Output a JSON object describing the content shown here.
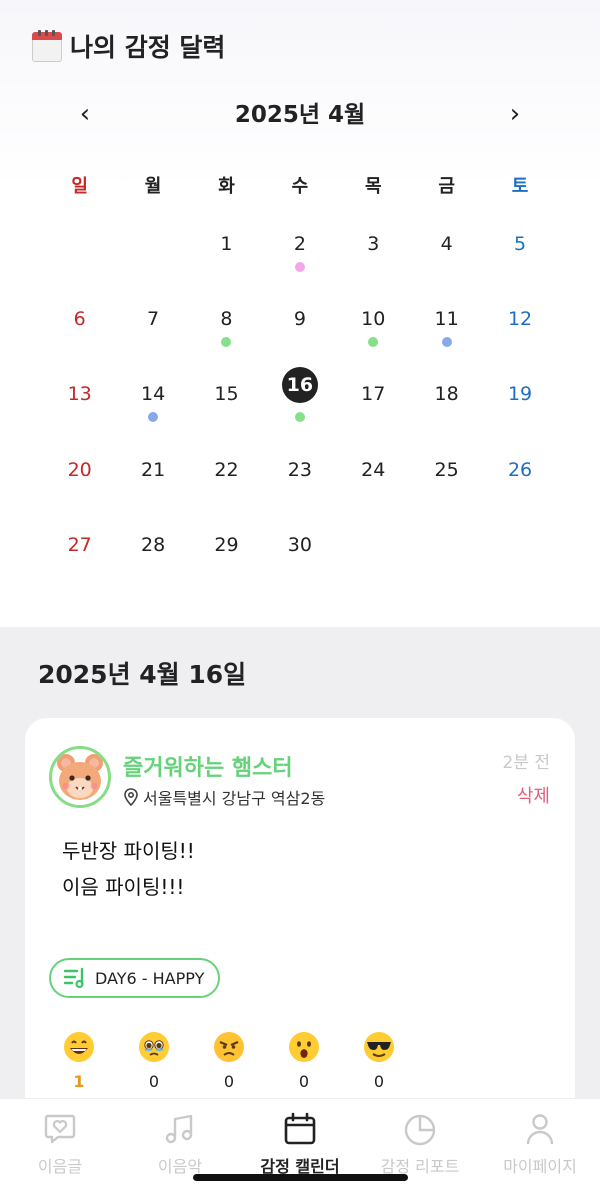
{
  "header": {
    "title": "나의 감정 달력",
    "icon": "calendar-emoji-icon"
  },
  "month_nav": {
    "prev": "‹",
    "label": "2025년 4월",
    "next": "›"
  },
  "weekdays": [
    "일",
    "월",
    "화",
    "수",
    "목",
    "금",
    "토"
  ],
  "calendar": {
    "leading_blanks": 2,
    "days": [
      {
        "n": "1"
      },
      {
        "n": "2",
        "dot": "#f4a6e8"
      },
      {
        "n": "3"
      },
      {
        "n": "4"
      },
      {
        "n": "5"
      },
      {
        "n": "6"
      },
      {
        "n": "7"
      },
      {
        "n": "8",
        "dot": "#86e08a"
      },
      {
        "n": "9"
      },
      {
        "n": "10",
        "dot": "#86e08a"
      },
      {
        "n": "11",
        "dot": "#86a9ea"
      },
      {
        "n": "12"
      },
      {
        "n": "13"
      },
      {
        "n": "14",
        "dot": "#86a9ea"
      },
      {
        "n": "15"
      },
      {
        "n": "16",
        "dot": "#86e08a",
        "selected": true
      },
      {
        "n": "17"
      },
      {
        "n": "18"
      },
      {
        "n": "19"
      },
      {
        "n": "20"
      },
      {
        "n": "21"
      },
      {
        "n": "22"
      },
      {
        "n": "23"
      },
      {
        "n": "24"
      },
      {
        "n": "25"
      },
      {
        "n": "26"
      },
      {
        "n": "27"
      },
      {
        "n": "28"
      },
      {
        "n": "29"
      },
      {
        "n": "30"
      }
    ]
  },
  "selected_date": "2025년 4월 16일",
  "post": {
    "avatar": "hamster-icon",
    "emotion_name": "즐거워하는 햄스터",
    "location": "서울특별시 강남구 역삼2동",
    "time_ago": "2분 전",
    "delete_label": "삭제",
    "lines": [
      "두반장 파이팅!!",
      "이음 파이팅!!!"
    ],
    "music": "DAY6 - HAPPY",
    "reactions": [
      {
        "icon": "grinning-face-icon",
        "count": "1",
        "active": true
      },
      {
        "icon": "teary-face-icon",
        "count": "0"
      },
      {
        "icon": "angry-face-icon",
        "count": "0"
      },
      {
        "icon": "surprised-face-icon",
        "count": "0"
      },
      {
        "icon": "sunglasses-face-icon",
        "count": "0"
      }
    ]
  },
  "tabs": [
    {
      "label": "이음글",
      "icon": "heart-message-icon"
    },
    {
      "label": "이음악",
      "icon": "music-note-icon"
    },
    {
      "label": "감정 캘린더",
      "icon": "calendar-icon",
      "active": true
    },
    {
      "label": "감정 리포트",
      "icon": "pie-chart-icon"
    },
    {
      "label": "마이페이지",
      "icon": "person-icon"
    }
  ],
  "colors": {
    "accent_green": "#66d27a",
    "sunday_red": "#c62828",
    "saturday_blue": "#1e6fc2",
    "delete_pink": "#e0607a",
    "reaction_active": "#e59a1a"
  }
}
